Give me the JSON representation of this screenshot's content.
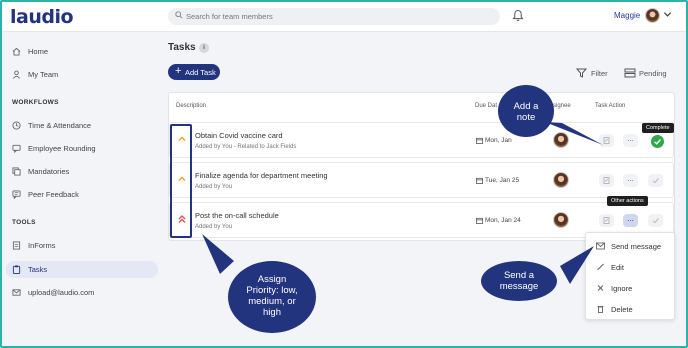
{
  "header": {
    "logo": "laudio",
    "search_placeholder": "Search for team members",
    "user_name": "Maggie"
  },
  "sidebar": {
    "items_top": [
      {
        "label": "Home",
        "icon": "home-icon"
      },
      {
        "label": "My Team",
        "icon": "team-icon"
      }
    ],
    "workflows_heading": "WORKFLOWS",
    "workflows": [
      {
        "label": "Time & Attendance",
        "icon": "clock-icon"
      },
      {
        "label": "Employee Rounding",
        "icon": "chat-icon"
      },
      {
        "label": "Mandatories",
        "icon": "stack-icon"
      },
      {
        "label": "Peer Feedback",
        "icon": "feedback-icon"
      }
    ],
    "tools_heading": "TOOLS",
    "tools": [
      {
        "label": "InForms",
        "icon": "form-icon",
        "active": false
      },
      {
        "label": "Tasks",
        "icon": "clipboard-icon",
        "active": true
      },
      {
        "label": "upload@laudio.com",
        "icon": "upload-mail-icon",
        "active": false
      }
    ]
  },
  "main": {
    "title": "Tasks",
    "info_symbol": "i",
    "add_task_label": "Add Task",
    "filter_label": "Filter",
    "pending_label": "Pending",
    "columns": {
      "description": "Description",
      "due_date": "Due Dat",
      "assignee": "Assignee",
      "task_action": "Task Action"
    },
    "rows": [
      {
        "title": "Obtain Covid vaccine card",
        "subtitle": "Added by You - Related to Jack Fields",
        "due": "Mon, Jan",
        "priority": "medium"
      },
      {
        "title": "Finalize agenda for department meeting",
        "subtitle": "Added by You",
        "due": "Tue, Jan 25",
        "priority": "medium"
      },
      {
        "title": "Post the on-call schedule",
        "subtitle": "Added by You",
        "due": "Mon, Jan 24",
        "priority": "high"
      }
    ],
    "complete_tooltip": "Complete",
    "other_actions_tooltip": "Other actions",
    "menu": [
      {
        "label": "Send message",
        "icon": "envelope-icon"
      },
      {
        "label": "Edit",
        "icon": "pencil-icon"
      },
      {
        "label": "Ignore",
        "icon": "x-icon"
      },
      {
        "label": "Delete",
        "icon": "trash-icon"
      }
    ]
  },
  "callouts": {
    "note": [
      "Add a",
      "note"
    ],
    "priority": [
      "Assign",
      "Priority: low,",
      "medium, or",
      "high"
    ],
    "message": [
      "Send a",
      "message"
    ]
  },
  "colors": {
    "brand": "#23347f",
    "medium_priority": "#f0a020",
    "high_priority": "#e85050",
    "complete_green": "#2ea84a",
    "frame": "#2ab3a8"
  }
}
